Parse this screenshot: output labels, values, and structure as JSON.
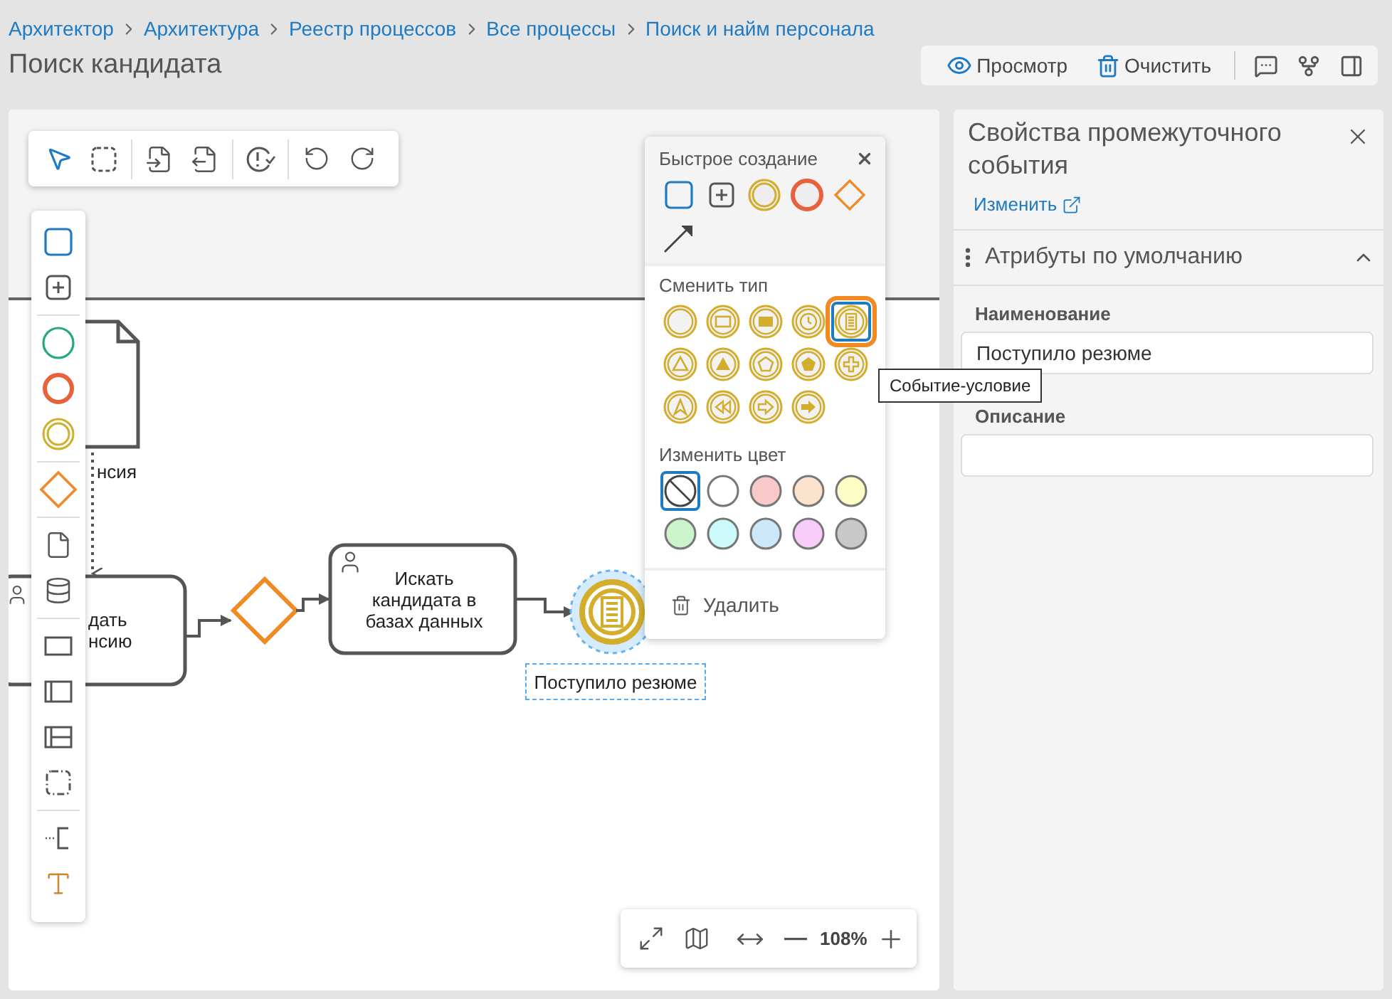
{
  "breadcrumbs": [
    "Архитектор",
    "Архитектура",
    "Реестр процессов",
    "Все процессы",
    "Поиск и найм персонала"
  ],
  "title": "Поиск кандидата",
  "actions": [
    {
      "kind": "view",
      "label": "Просмотр"
    },
    {
      "kind": "clear",
      "label": "Очистить"
    }
  ],
  "diagram": {
    "document_label": "нсия",
    "task_1_lines": [
      "дать",
      "нсию"
    ],
    "task_2": "Искать кандидата в базах данных",
    "event": {
      "label": "Поступило резюме",
      "selected": true
    }
  },
  "zoom": "108%",
  "quick_menu": {
    "create_title": "Быстрое создание",
    "change_type_title": "Сменить тип",
    "event_types": [
      {
        "kind": "none",
        "selected": false
      },
      {
        "kind": "message",
        "selected": false
      },
      {
        "kind": "message-filled",
        "selected": false
      },
      {
        "kind": "timer",
        "selected": false
      },
      {
        "kind": "conditional",
        "selected": true
      },
      {
        "kind": "signal",
        "selected": false
      },
      {
        "kind": "signal-filled",
        "selected": false
      },
      {
        "kind": "multiple",
        "selected": false
      },
      {
        "kind": "multiple-filled",
        "selected": false
      },
      {
        "kind": "parallel",
        "selected": false
      },
      {
        "kind": "escalation",
        "selected": false
      },
      {
        "kind": "compensation",
        "selected": false
      },
      {
        "kind": "link",
        "selected": false
      },
      {
        "kind": "link-filled",
        "selected": false
      }
    ],
    "change_color_title": "Изменить цвет",
    "colors": [
      {
        "kind": "none",
        "selected": true
      },
      {
        "kind": "swatch",
        "color": "#ffffff",
        "selected": false
      },
      {
        "kind": "swatch",
        "color": "#f9c9c9",
        "selected": false
      },
      {
        "kind": "swatch",
        "color": "#fbe2cc",
        "selected": false
      },
      {
        "kind": "swatch",
        "color": "#fdfdc6",
        "selected": false
      },
      {
        "kind": "swatch",
        "color": "#ccf4cc",
        "selected": false
      },
      {
        "kind": "swatch",
        "color": "#ccfafa",
        "selected": false
      },
      {
        "kind": "swatch",
        "color": "#cce6fa",
        "selected": false
      },
      {
        "kind": "swatch",
        "color": "#f8ccf8",
        "selected": false
      },
      {
        "kind": "swatch",
        "color": "#c8c8c8",
        "selected": false
      }
    ],
    "delete": "Удалить",
    "tooltip": "Событие-условие"
  },
  "panel": {
    "title": "Свойства промежуточного события",
    "change_link": "Изменить",
    "section": {
      "title": "Атрибуты по умолчанию",
      "expanded": true
    },
    "fields": [
      {
        "label": "Наименование",
        "value": "Поступило резюме"
      },
      {
        "label": "Описание"
      }
    ]
  }
}
